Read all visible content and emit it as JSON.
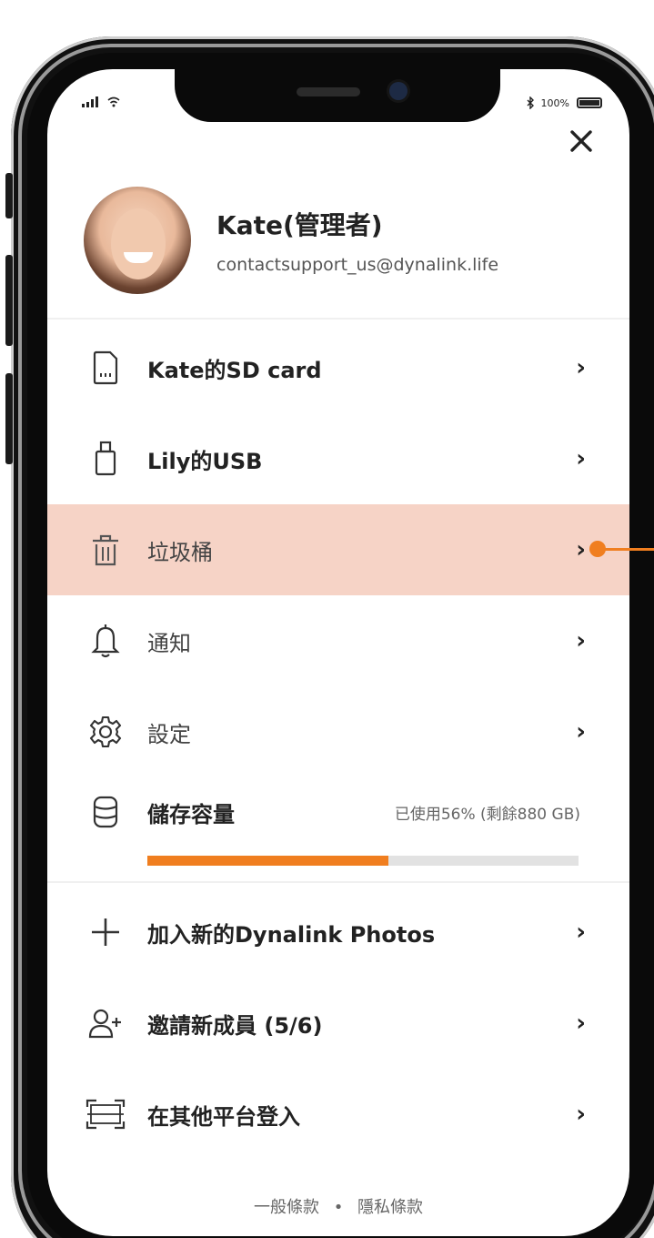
{
  "status_bar": {
    "battery_text": "100%",
    "signal_icon": "cellular-signal-icon",
    "wifi_icon": "wifi-icon",
    "bluetooth_icon": "bluetooth-icon"
  },
  "header": {
    "close_icon": "close-icon"
  },
  "profile": {
    "name": "Kate(管理者)",
    "email": "contactsupport_us@dynalink.life"
  },
  "menu": {
    "sd_card": {
      "label": "Kate的SD card",
      "icon": "sd-card-icon"
    },
    "usb": {
      "label": "Lily的USB",
      "icon": "usb-icon"
    },
    "trash": {
      "label": "垃圾桶",
      "icon": "trash-icon"
    },
    "notifications": {
      "label": "通知",
      "icon": "bell-icon"
    },
    "settings": {
      "label": "設定",
      "icon": "gear-icon"
    },
    "add_photos": {
      "label": "加入新的Dynalink Photos",
      "icon": "plus-icon"
    },
    "invite": {
      "label": "邀請新成員 (5/6)",
      "icon": "add-user-icon"
    },
    "other_login": {
      "label": "在其他平台登入",
      "icon": "scan-icon"
    }
  },
  "storage": {
    "label": "儲存容量",
    "usage_text": "已使用56% (剩餘880 GB)",
    "used_fraction": 0.56,
    "icon": "database-icon"
  },
  "footer": {
    "terms": "一般條款",
    "separator": "•",
    "privacy": "隱私條款"
  },
  "colors": {
    "accent": "#f07e1f",
    "highlight_row": "#f6d3c6",
    "text": "#222222"
  }
}
